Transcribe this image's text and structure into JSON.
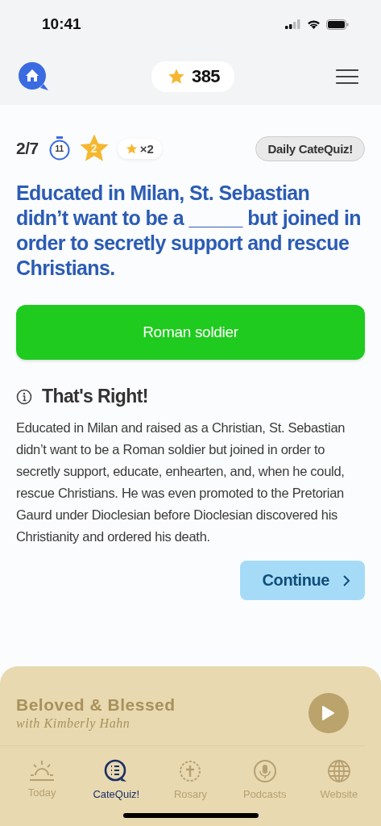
{
  "status_bar": {
    "time": "10:41"
  },
  "header": {
    "stars": "385"
  },
  "quiz": {
    "progress": "2/7",
    "timer": "11",
    "star_count": "2",
    "multiplier": "×2",
    "badge": "Daily CateQuiz!"
  },
  "question": "Educated in Milan, St. Sebastian didn’t want to be a _____ but joined in order to secretly support and rescue Christians.",
  "answer": {
    "text": "Roman soldier",
    "correct": true
  },
  "feedback": {
    "title": "That's Right!",
    "body": "Educated in Milan and raised as a Christian, St. Sebastian didn’t want to be a Roman soldier but joined in order to secretly support, educate, enhearten, and, when he could, rescue Christians. He was even promoted to the Pretorian Gaurd under Dioclesian before Dioclesian discovered his Christianity and ordered his death."
  },
  "continue_button": "Continue",
  "player": {
    "title": "Beloved & Blessed",
    "subtitle": "with Kimberly Hahn"
  },
  "tabs": [
    {
      "kind": "sun",
      "label": "Today",
      "selected": false
    },
    {
      "kind": "quiz",
      "label": "CateQuiz!",
      "selected": true
    },
    {
      "kind": "rosary",
      "label": "Rosary",
      "selected": false
    },
    {
      "kind": "mic",
      "label": "Podcasts",
      "selected": false
    },
    {
      "kind": "globe",
      "label": "Website",
      "selected": false
    }
  ]
}
